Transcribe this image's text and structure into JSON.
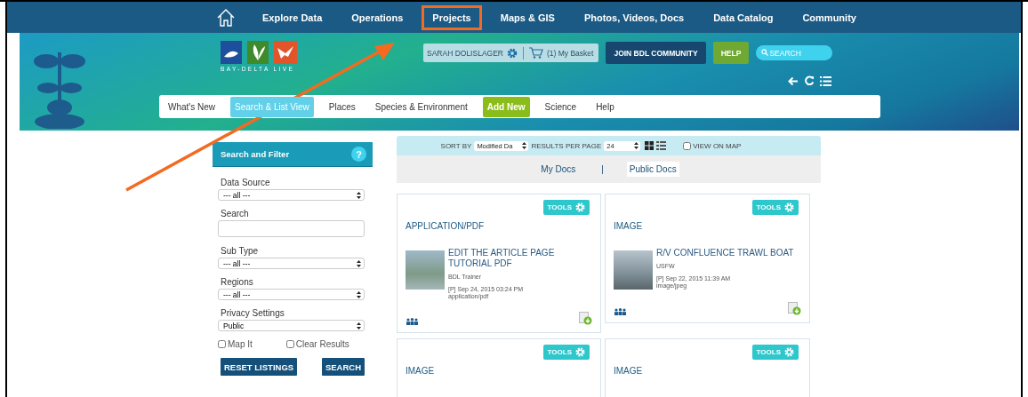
{
  "top_nav": {
    "items": [
      {
        "label": "Explore Data",
        "highlighted": false
      },
      {
        "label": "Operations",
        "highlighted": false
      },
      {
        "label": "Projects",
        "highlighted": true
      },
      {
        "label": "Maps & GIS",
        "highlighted": false
      },
      {
        "label": "Photos, Videos, Docs",
        "highlighted": false
      },
      {
        "label": "Data Catalog",
        "highlighted": false
      },
      {
        "label": "Community",
        "highlighted": false
      }
    ]
  },
  "logo": {
    "text": "BAY-DELTA LIVE"
  },
  "user": {
    "name": "SARAH DOLISLAGER",
    "basket": "(1) My Basket"
  },
  "header_buttons": [
    {
      "label": "JOIN BDL COMMUNITY",
      "kind": "dark"
    },
    {
      "label": "HELP",
      "kind": "green"
    }
  ],
  "search": {
    "placeholder": "SEARCH"
  },
  "sub_nav": [
    {
      "label": "What's New",
      "selected": false,
      "kind": "link"
    },
    {
      "label": "Search & List View",
      "selected": true,
      "kind": "link"
    },
    {
      "label": "Places",
      "selected": false,
      "kind": "link"
    },
    {
      "label": "Species & Environment",
      "selected": false,
      "kind": "link"
    },
    {
      "label": "Add New",
      "selected": false,
      "kind": "action"
    },
    {
      "label": "Science",
      "selected": false,
      "kind": "link"
    },
    {
      "label": "Help",
      "selected": false,
      "kind": "link"
    }
  ],
  "filter": {
    "title": "Search and Filter",
    "help": "?",
    "fields": [
      {
        "label": "Data Source",
        "kind": "select",
        "value": "--- all ---"
      },
      {
        "label": "Search",
        "kind": "text"
      },
      {
        "label": "Sub Type",
        "kind": "select",
        "value": "--- all ---"
      },
      {
        "label": "Regions",
        "kind": "select",
        "value": "--- all ---"
      },
      {
        "label": "Privacy Settings",
        "kind": "select",
        "value": "Public"
      }
    ],
    "checkboxes": [
      {
        "label": "Map It",
        "checked": false
      },
      {
        "label": "Clear Results",
        "checked": false
      }
    ],
    "buttons": [
      "RESET LISTINGS",
      "SEARCH"
    ]
  },
  "toolbar": {
    "sort_label": "SORT BY",
    "sort_value": "Modified Da",
    "per_page_label": "RESULTS PER PAGE",
    "per_page_value": "24",
    "view_modes": [
      {
        "kind": "grid",
        "selected": true
      },
      {
        "kind": "list",
        "selected": false
      }
    ],
    "view_on_map": {
      "label": "VIEW ON MAP",
      "checked": false
    }
  },
  "doc_tabs": {
    "separator": "|",
    "tabs": [
      {
        "label": "My Docs",
        "selected": false
      },
      {
        "label": "Public Docs",
        "selected": true
      }
    ]
  },
  "cards": [
    {
      "tools": "TOOLS",
      "type": "APPLICATION/PDF",
      "kind": "document",
      "title": "EDIT THE ARTICLE PAGE TUTORIAL PDF",
      "author": "BDL Trainer",
      "date": "[P] Sep 24, 2015 03:24 PM",
      "mime": "application/pdf"
    },
    {
      "tools": "TOOLS",
      "type": "IMAGE",
      "kind": "photo",
      "title": "R/V CONFLUENCE TRAWL BOAT",
      "author": "USFW",
      "date": "[P] Sep 22, 2015 11:39 AM",
      "mime": "image/jpeg"
    },
    {
      "tools": "TOOLS",
      "type": "IMAGE"
    },
    {
      "tools": "TOOLS",
      "type": "IMAGE"
    }
  ]
}
